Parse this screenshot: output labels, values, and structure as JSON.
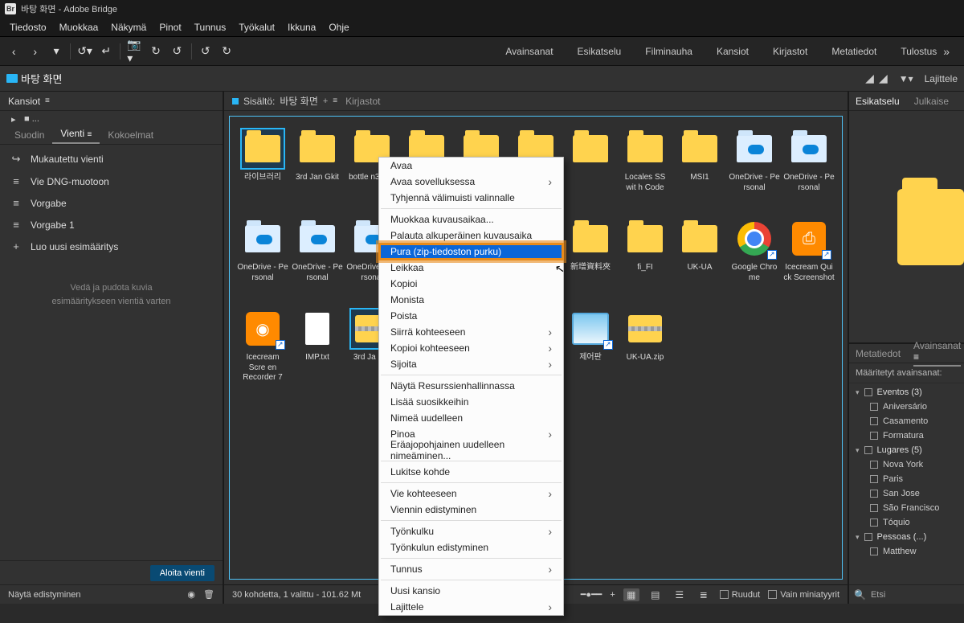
{
  "title": "바탕 화면 - Adobe Bridge",
  "menubar": [
    "Tiedosto",
    "Muokkaa",
    "Näkymä",
    "Pinot",
    "Tunnus",
    "Työkalut",
    "Ikkuna",
    "Ohje"
  ],
  "workspaces": [
    "Avainsanat",
    "Esikatselu",
    "Filminauha",
    "Kansiot",
    "Kirjastot",
    "Metatiedot",
    "Tulostus"
  ],
  "path_label": "바탕 화면",
  "sort_button": "Lajittele",
  "left": {
    "panel_title": "Kansiot",
    "tabs": {
      "filter": "Suodin",
      "export": "Vienti",
      "collections": "Kokoelmat"
    },
    "export_items": [
      {
        "icon": "↪",
        "label": "Mukautettu vienti"
      },
      {
        "icon": "≡",
        "label": "Vie DNG-muotoon"
      },
      {
        "icon": "≡",
        "label": "Vorgabe"
      },
      {
        "icon": "≡",
        "label": "Vorgabe 1"
      },
      {
        "icon": "+",
        "label": "Luo uusi esimääritys"
      }
    ],
    "drop_hint_1": "Vedä ja pudota kuvia",
    "drop_hint_2": "esimääritykseen vientiä varten",
    "start_export": "Aloita vienti",
    "progress_label": "Näytä edistyminen"
  },
  "center": {
    "content_label": "Sisältö:",
    "content_path": "바탕 화면",
    "lib_tab": "Kirjastot",
    "items": [
      {
        "t": "folder",
        "lbl": "라이브러리",
        "sel": true
      },
      {
        "t": "folder",
        "lbl": "3rd Jan Gkit"
      },
      {
        "t": "folder",
        "lbl": "bottle n3d_..."
      },
      {
        "t": "folder",
        "lbl": ""
      },
      {
        "t": "folder",
        "lbl": ""
      },
      {
        "t": "folder",
        "lbl": ""
      },
      {
        "t": "folder",
        "lbl": ""
      },
      {
        "t": "folder",
        "lbl": "Locales SS wit h Code"
      },
      {
        "t": "folder",
        "lbl": "MSI1"
      },
      {
        "t": "cloud",
        "lbl": "OneDrive - Pe rsonal"
      },
      {
        "t": "cloud",
        "lbl": "OneDrive - Pe rsonal"
      },
      {
        "t": "cloud",
        "lbl": "OneDrive - Pe rsonal"
      },
      {
        "t": "cloud",
        "lbl": "OneDrive - Pe rsonal"
      },
      {
        "t": "cloud",
        "lbl": "OneDrive - Pe rsonal"
      },
      {
        "t": "folder",
        "lbl": ""
      },
      {
        "t": "folder",
        "lbl": ""
      },
      {
        "t": "folder",
        "lbl": ""
      },
      {
        "t": "folder",
        "lbl": "新增資料夾"
      },
      {
        "t": "folder",
        "lbl": "fi_FI"
      },
      {
        "t": "folder",
        "lbl": "UK-UA"
      },
      {
        "t": "chrome",
        "lbl": "Google Chro me",
        "sc": true
      },
      {
        "t": "camera",
        "lbl": "Icecream Qui ck Screenshot",
        "sc": true
      },
      {
        "t": "rec",
        "lbl": "Icecream Scre en Recorder 7",
        "sc": true
      },
      {
        "t": "txt",
        "lbl": "IMP.txt"
      },
      {
        "t": "zipsel",
        "lbl": "3rd Ja .zip",
        "sel": true
      },
      {
        "t": "blank",
        "lbl": ""
      },
      {
        "t": "blank",
        "lbl": ""
      },
      {
        "t": "blank",
        "lbl": ""
      },
      {
        "t": "ctrl",
        "lbl": "제어판",
        "sc": true
      },
      {
        "t": "zip",
        "lbl": "UK-UA.zip"
      }
    ],
    "status": "30 kohdetta, 1 valittu - 101.62 Mt",
    "view_labels": {
      "grid": "Ruudut",
      "thumb": "Vain miniatyyrit"
    }
  },
  "context": [
    {
      "lbl": "Avaa"
    },
    {
      "lbl": "Avaa sovelluksessa",
      "sub": true
    },
    {
      "lbl": "Tyhjennä välimuisti valinnalle"
    },
    {
      "sep": true
    },
    {
      "lbl": "Muokkaa kuvausaikaa..."
    },
    {
      "lbl": "Palauta alkuperäinen kuvausaika"
    },
    {
      "lbl": "Pura (zip-tiedoston purku)",
      "hl": true
    },
    {
      "lbl": "Leikkaa"
    },
    {
      "lbl": "Kopioi"
    },
    {
      "lbl": "Monista"
    },
    {
      "lbl": "Poista"
    },
    {
      "lbl": "Siirrä kohteeseen",
      "sub": true
    },
    {
      "lbl": "Kopioi kohteeseen",
      "sub": true
    },
    {
      "lbl": "Sijoita",
      "sub": true
    },
    {
      "sep": true
    },
    {
      "lbl": "Näytä Resurssienhallinnassa"
    },
    {
      "lbl": "Lisää suosikkeihin"
    },
    {
      "lbl": "Nimeä uudelleen"
    },
    {
      "lbl": "Pinoa",
      "sub": true
    },
    {
      "lbl": "Eräajopohjainen uudelleen nimeäminen..."
    },
    {
      "sep": true
    },
    {
      "lbl": "Lukitse kohde"
    },
    {
      "sep": true
    },
    {
      "lbl": "Vie kohteeseen",
      "sub": true
    },
    {
      "lbl": "Viennin edistyminen"
    },
    {
      "sep": true
    },
    {
      "lbl": "Työnkulku",
      "sub": true
    },
    {
      "lbl": "Työnkulun edistyminen"
    },
    {
      "sep": true
    },
    {
      "lbl": "Tunnus",
      "sub": true
    },
    {
      "sep": true
    },
    {
      "lbl": "Uusi kansio"
    },
    {
      "lbl": "Lajittele",
      "sub": true
    }
  ],
  "right": {
    "preview_tab": "Esikatselu",
    "publish_tab": "Julkaise",
    "meta_tab": "Metatiedot",
    "kw_tab": "Avainsanat",
    "kw_header": "Määritetyt avainsanat:",
    "groups": [
      {
        "name": "Eventos",
        "count": "(3)",
        "items": [
          "Aniversário",
          "Casamento",
          "Formatura"
        ]
      },
      {
        "name": "Lugares",
        "count": "(5)",
        "items": [
          "Nova York",
          "Paris",
          "San Jose",
          "São Francisco",
          "Tóquio"
        ]
      },
      {
        "name": "Pessoas",
        "count": "(...)",
        "items": [
          "Matthew"
        ]
      }
    ],
    "search_ph": "Etsi"
  }
}
